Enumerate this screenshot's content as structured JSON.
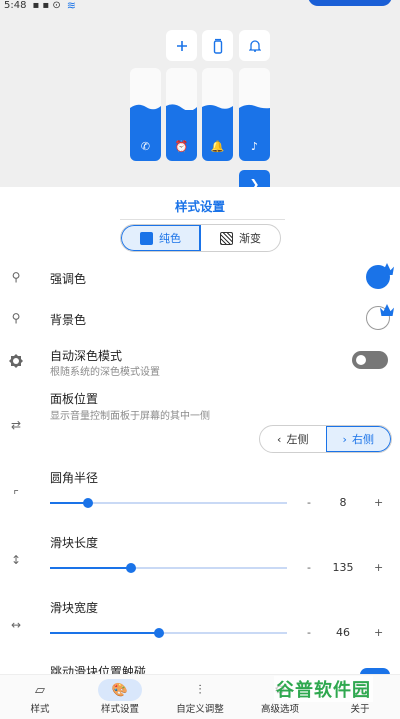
{
  "status": {
    "time": "5:48"
  },
  "preview": {
    "buttons": [
      "add-icon",
      "remote-icon",
      "bell-icon"
    ],
    "sliders": [
      {
        "icon": "phone-icon",
        "glyph": "✆",
        "level": 0.55
      },
      {
        "icon": "alarm-icon",
        "glyph": "⏰",
        "level": 0.55
      },
      {
        "icon": "bell-icon",
        "glyph": "🔔",
        "level": 0.55
      },
      {
        "icon": "music-icon",
        "glyph": "♪",
        "level": 0.55
      }
    ]
  },
  "sheet": {
    "title": "样式设置",
    "style_tabs": {
      "solid": "纯色",
      "gradient": "渐变"
    },
    "accent_label": "强调色",
    "bg_label": "背景色",
    "dark_mode": {
      "label": "自动深色模式",
      "desc": "根随系统的深色模式设置"
    },
    "panel_pos": {
      "label": "面板位置",
      "desc": "显示音量控制面板于屏幕的其中一侧",
      "left": "左侧",
      "right": "右侧"
    },
    "corner": {
      "label": "圆角半径",
      "value": "8",
      "level": 0.16
    },
    "slider_len": {
      "label": "滑块长度",
      "value": "135",
      "level": 0.34
    },
    "slider_width": {
      "label": "滑块宽度",
      "value": "46",
      "level": 0.46
    },
    "next_label": "跳动滑块位置触碰",
    "minus": "-",
    "plus": "+"
  },
  "nav": [
    {
      "label": "样式",
      "icon": "layers-icon"
    },
    {
      "label": "样式设置",
      "icon": "palette-icon",
      "active": true
    },
    {
      "label": "自定义调整",
      "icon": "tune-icon"
    },
    {
      "label": "高级选项",
      "icon": "advanced-icon"
    },
    {
      "label": "关于",
      "icon": "info-icon"
    }
  ],
  "watermark": "谷普软件园",
  "colors": {
    "accent": "#1a73e8"
  }
}
